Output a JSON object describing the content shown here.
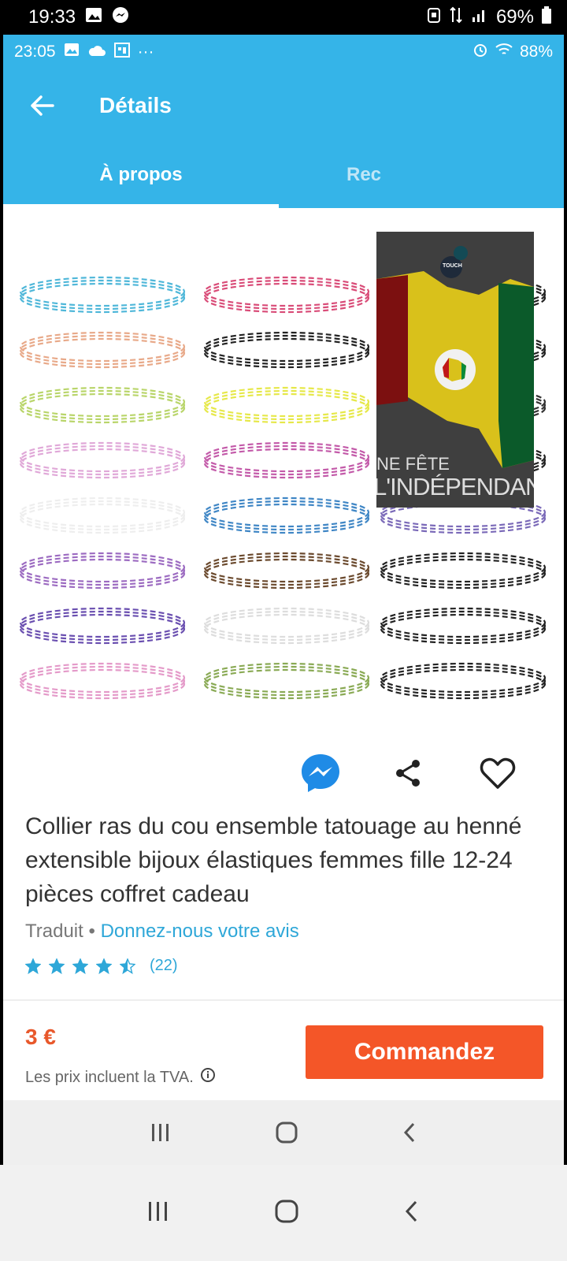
{
  "outer_status": {
    "time": "19:33",
    "battery": "69%"
  },
  "inner_status": {
    "time": "23:05",
    "more": "···",
    "battery": "88%"
  },
  "appbar": {
    "title": "Détails"
  },
  "tabs": [
    {
      "label": "À propos"
    },
    {
      "label": "Rec"
    }
  ],
  "overlay": {
    "logo_text": "TOUCH",
    "line1": "NE FÊTE",
    "line2": "L'INDÉPENDAN"
  },
  "product": {
    "title": "Collier ras du cou ensemble tatouage au henné extensible bijoux élastiques femmes fille 12-24 pièces coffret cadeau",
    "translated_label": "Traduit",
    "separator": " • ",
    "feedback_link": "Donnez-nous votre avis",
    "rating_value": 4.5,
    "review_count": "(22)"
  },
  "purchase": {
    "price": "3 €",
    "vat_note": "Les prix incluent la TVA.",
    "order_label": "Commandez"
  },
  "colors": {
    "primary": "#35b4e8",
    "order": "#f45628",
    "price": "#e8582b",
    "link": "#2ea7d8"
  }
}
